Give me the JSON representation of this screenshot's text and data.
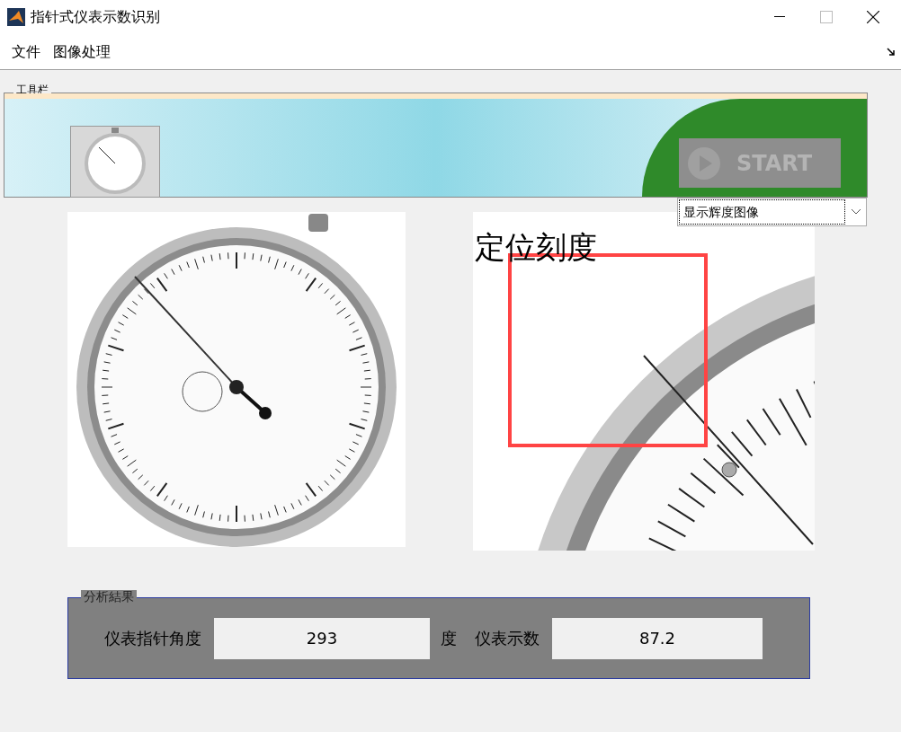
{
  "window": {
    "title": "指针式仪表示数识别"
  },
  "menu": [
    "文件",
    "图像处理"
  ],
  "toolbar": {
    "title": "工具栏",
    "start_button": {
      "label": "START",
      "disabled": true
    },
    "dropdown": {
      "value": "显示辉度图像"
    }
  },
  "axes_right": {
    "title": "定位刻度"
  },
  "results": {
    "title": "分析結果",
    "fields": [
      {
        "label": "仪表指针角度",
        "value": "293",
        "unit": "度"
      },
      {
        "label": "仪表示数",
        "value": "87.2"
      }
    ]
  }
}
